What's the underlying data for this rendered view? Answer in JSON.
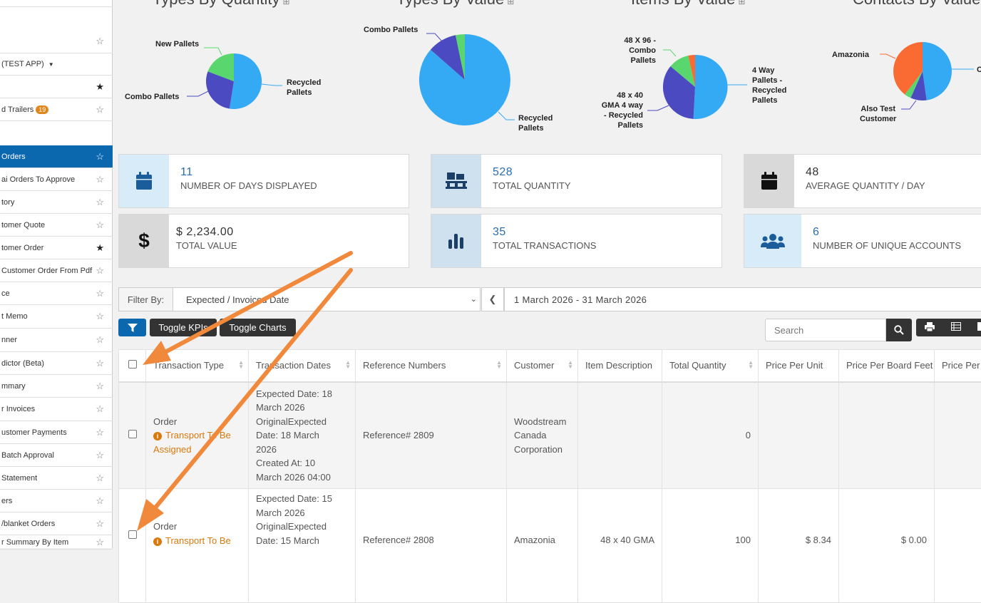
{
  "sidebar": {
    "items": [
      {
        "label": "",
        "star": "outline"
      },
      {
        "label": "(TEST APP)",
        "star": "none",
        "caret": true
      },
      {
        "label": "",
        "star": "filled"
      },
      {
        "label": "d Trailers",
        "badge": "19",
        "star": "outline"
      },
      {
        "label": "Orders",
        "star": "outline",
        "active": true
      },
      {
        "label": "ai Orders To Approve",
        "star": "outline"
      },
      {
        "label": "tory",
        "star": "outline"
      },
      {
        "label": "tomer Quote",
        "star": "outline"
      },
      {
        "label": "tomer Order",
        "star": "filled"
      },
      {
        "label": "Customer Order From Pdf",
        "star": "outline"
      },
      {
        "label": "ce",
        "star": "outline"
      },
      {
        "label": "t Memo",
        "star": "outline"
      },
      {
        "label": "nner",
        "star": "outline"
      },
      {
        "label": "dictor (Beta)",
        "star": "outline"
      },
      {
        "label": "mmary",
        "star": "outline"
      },
      {
        "label": "r Invoices",
        "star": "outline"
      },
      {
        "label": "ustomer Payments",
        "star": "outline"
      },
      {
        "label": "Batch Approval",
        "star": "outline"
      },
      {
        "label": "Statement",
        "star": "outline"
      },
      {
        "label": "ers",
        "star": "outline"
      },
      {
        "label": "/blanket Orders",
        "star": "outline"
      },
      {
        "label": "r Summary By Item",
        "star": "outline"
      }
    ]
  },
  "charts": {
    "titles": [
      "Types By Quantity",
      "Types By Value",
      "Items By Value",
      "Contacts By Value"
    ],
    "labels": {
      "q_new": "New Pallets",
      "q_combo": "Combo Pallets",
      "q_recycled": "Recycled\nPallets",
      "v_combo": "Combo Pallets",
      "v_recycled": "Recycled\nPallets",
      "i_48x96": "48 X 96 -\nCombo\nPallets",
      "i_48x40": "48 x 40\nGMA 4 way\n- Recycled\nPallets",
      "i_4way": "4 Way\nPallets -\nRecycled\nPallets",
      "c_amazonia": "Amazonia",
      "c_also": "Also Test\nCustomer",
      "c_edge": "C"
    }
  },
  "kpis": [
    {
      "value": "11",
      "label": "Number of days displayed",
      "icon": "calendar-icon"
    },
    {
      "value": "528",
      "label": "Total Quantity",
      "icon": "pallet-icon"
    },
    {
      "value": "48",
      "label": "Average Quantity / Day",
      "icon": "calendar-icon"
    },
    {
      "value": "$ 2,234.00",
      "label": "Total Value",
      "icon": "dollar-icon"
    },
    {
      "value": "35",
      "label": "Total Transactions",
      "icon": "bar-chart-icon"
    },
    {
      "value": "6",
      "label": "Number of unique accounts",
      "icon": "users-icon"
    }
  ],
  "filter": {
    "label": "Filter By:",
    "selected": "Expected / Invoiced Date",
    "date_range": "1 March 2026 - 31 March 2026"
  },
  "toolbar": {
    "toggle_kpis": "Toggle KPIs",
    "toggle_charts": "Toggle Charts",
    "search_placeholder": "Search"
  },
  "table": {
    "columns": [
      "Transaction Type",
      "Transaction Dates",
      "Reference Numbers",
      "Customer",
      "Item Description",
      "Total Quantity",
      "Price Per Unit",
      "Price Per Board Feet",
      "Price Per"
    ],
    "rows": [
      {
        "type": "Order",
        "status": "Transport To Be Assigned",
        "dates": [
          "Expected Date: 18",
          "March 2026",
          "OriginalExpected",
          "Date: 18 March",
          "2026",
          "Created At: 10",
          "March 2026 04:00"
        ],
        "reference": "Reference# 2809",
        "customer": [
          "Woodstream",
          "Canada",
          "Corporation"
        ],
        "item": "",
        "quantity": "0",
        "price_unit": "",
        "price_bf": ""
      },
      {
        "type": "Order",
        "status": "Transport To Be",
        "dates": [
          "Expected Date: 15",
          "March 2026",
          "OriginalExpected",
          "Date: 15 March"
        ],
        "reference": "Reference# 2808",
        "customer": [
          "Amazonia"
        ],
        "item": "48 x 40 GMA",
        "quantity": "100",
        "price_unit": "$ 8.34",
        "price_bf": "$ 0.00"
      }
    ]
  },
  "colors": {
    "accent": "#0b67ae",
    "pie_blue": "#35aaf4",
    "pie_purple": "#4c4ac0",
    "pie_green": "#5ad66f",
    "pie_orange": "#fa6b34",
    "arrow": "#f0893b",
    "status_orange": "#d9780b"
  }
}
